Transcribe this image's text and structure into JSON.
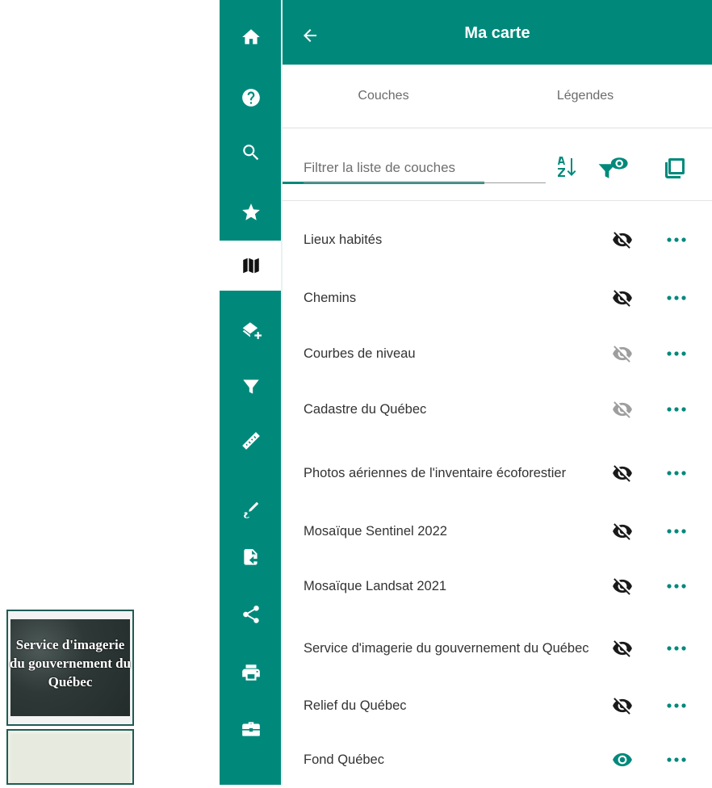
{
  "thumbnails": [
    {
      "caption": "Service d'imagerie du gouvernement du Québec"
    },
    {
      "caption": ""
    }
  ],
  "rail": {
    "items": [
      {
        "icon": "home-icon"
      },
      {
        "icon": "help-icon"
      },
      {
        "icon": "search-icon"
      },
      {
        "icon": "star-icon"
      },
      {
        "icon": "map-icon",
        "active": true
      },
      {
        "icon": "add-layer-icon"
      },
      {
        "icon": "filter-icon"
      },
      {
        "icon": "ruler-icon"
      },
      {
        "icon": "draw-icon"
      },
      {
        "icon": "import-file-icon"
      },
      {
        "icon": "share-icon"
      },
      {
        "icon": "print-icon"
      },
      {
        "icon": "toolbox-icon"
      }
    ]
  },
  "panel": {
    "title": "Ma carte",
    "back_icon": "arrow-left-icon",
    "tabs": [
      {
        "label": "Couches",
        "active": true
      },
      {
        "label": "Légendes",
        "active": false
      }
    ],
    "filter": {
      "placeholder": "Filtrer la liste de couches",
      "value": ""
    },
    "tools": [
      "sort-alpha-icon",
      "visible-filter-icon",
      "select-all-icon"
    ]
  },
  "layers": [
    {
      "name": "Lieux habités",
      "visibility": "hidden"
    },
    {
      "name": "Chemins",
      "visibility": "hidden"
    },
    {
      "name": "Courbes de niveau",
      "visibility": "hidden-disabled"
    },
    {
      "name": "Cadastre du Québec",
      "visibility": "hidden-disabled"
    },
    {
      "name": "Photos aériennes de l'inventaire écoforestier",
      "visibility": "hidden"
    },
    {
      "name": "Mosaïque Sentinel 2022",
      "visibility": "hidden"
    },
    {
      "name": "Mosaïque Landsat 2021",
      "visibility": "hidden"
    },
    {
      "name": "Service d'imagerie du gouvernement du Québec",
      "visibility": "hidden"
    },
    {
      "name": "Relief du Québec",
      "visibility": "hidden"
    },
    {
      "name": "Fond Québec",
      "visibility": "visible"
    }
  ],
  "colors": {
    "accent": "#00897b",
    "icon_dark": "#1a1a1a",
    "icon_disabled": "#9e9e9e"
  }
}
